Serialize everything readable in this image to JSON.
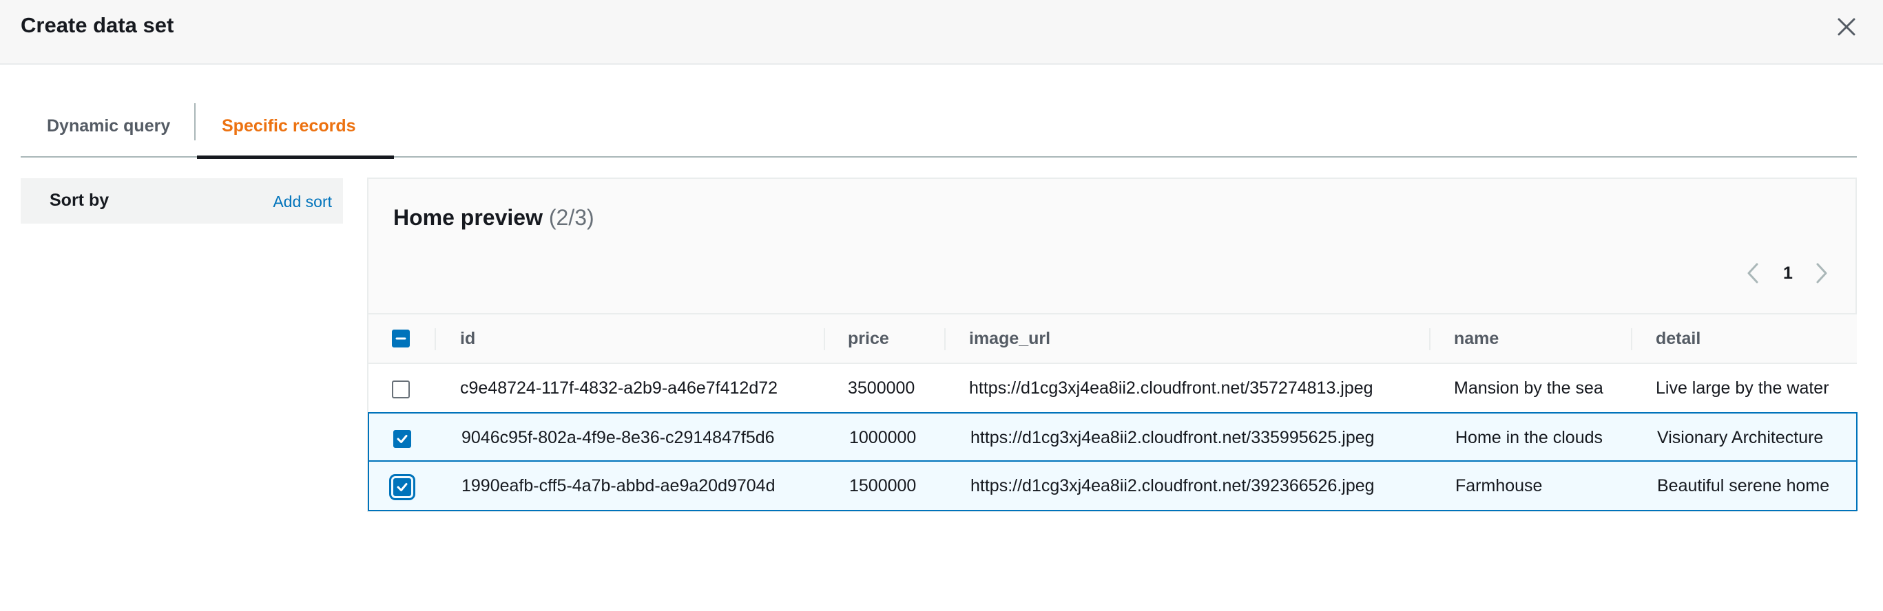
{
  "modal": {
    "title": "Create data set"
  },
  "tabs": [
    {
      "label": "Dynamic query",
      "active": false
    },
    {
      "label": "Specific records",
      "active": true
    }
  ],
  "sort": {
    "label": "Sort by",
    "add_sort": "Add sort"
  },
  "preview": {
    "title": "Home preview",
    "count": "(2/3)",
    "current_page": "1"
  },
  "table": {
    "columns": [
      "id",
      "price",
      "image_url",
      "name",
      "detail"
    ],
    "header_checkbox": "indeterminate",
    "rows": [
      {
        "selected": false,
        "id": "c9e48724-117f-4832-a2b9-a46e7f412d72",
        "price": "3500000",
        "image_url": "https://d1cg3xj4ea8ii2.cloudfront.net/357274813.jpeg",
        "name": "Mansion by the sea",
        "detail": "Live large by the water"
      },
      {
        "selected": true,
        "id": "9046c95f-802a-4f9e-8e36-c2914847f5d6",
        "price": "1000000",
        "image_url": "https://d1cg3xj4ea8ii2.cloudfront.net/335995625.jpeg",
        "name": "Home in the clouds",
        "detail": "Visionary Architecture"
      },
      {
        "selected": true,
        "id": "1990eafb-cff5-4a7b-abbd-ae9a20d9704d",
        "price": "1500000",
        "image_url": "https://d1cg3xj4ea8ii2.cloudfront.net/392366526.jpeg",
        "name": "Farmhouse",
        "detail": "Beautiful serene home"
      }
    ]
  },
  "colors": {
    "accent": "#ec7211",
    "link": "#0073bb",
    "selected_row_bg": "#f1faff"
  },
  "icons": {
    "close": "close-icon",
    "prev": "chevron-left-icon",
    "next": "chevron-right-icon"
  }
}
